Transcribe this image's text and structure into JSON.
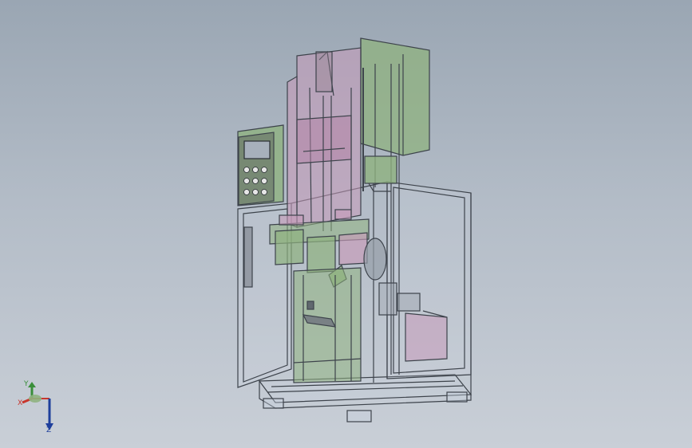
{
  "colors": {
    "background_top": "#9aa6b3",
    "background_bottom": "#c9cfd7",
    "frame_edge": "#3d434b",
    "green_part": "#8fb27f",
    "pink_part": "#c79bb9",
    "axis_x": "#c8362d",
    "axis_y": "#3a8e3a",
    "axis_z": "#1e3f9c"
  },
  "orientation_triad": {
    "x_label": "X",
    "y_label": "Y",
    "z_label": "Z"
  }
}
